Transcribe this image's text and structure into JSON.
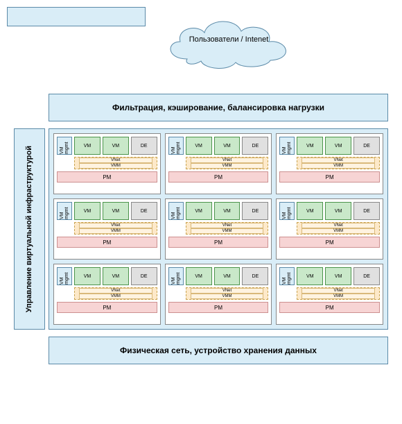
{
  "cloud": {
    "label": "Пользователи / Intenet"
  },
  "top": {
    "label": "Фильтрация, кэширование, балансировка нагрузки"
  },
  "left": {
    "label": "Управление виртуальной инфраструктурой"
  },
  "bottom": {
    "label": "Физическая сеть, устройство хранения данных"
  },
  "pm": {
    "vm_mgmt": "VM mgmt",
    "vm": "VM",
    "de": "DE",
    "vnet": "VNet",
    "vmm": "VMM",
    "pm": "PM"
  },
  "colors": {
    "light_blue": "#d9edf7",
    "blue_border": "#5b8aa8",
    "green": "#c9e8c9",
    "green_border": "#4a934a",
    "orange": "#fde9c9",
    "pink": "#f7d4d4"
  },
  "grid": {
    "rows": 3,
    "cols": 3
  }
}
